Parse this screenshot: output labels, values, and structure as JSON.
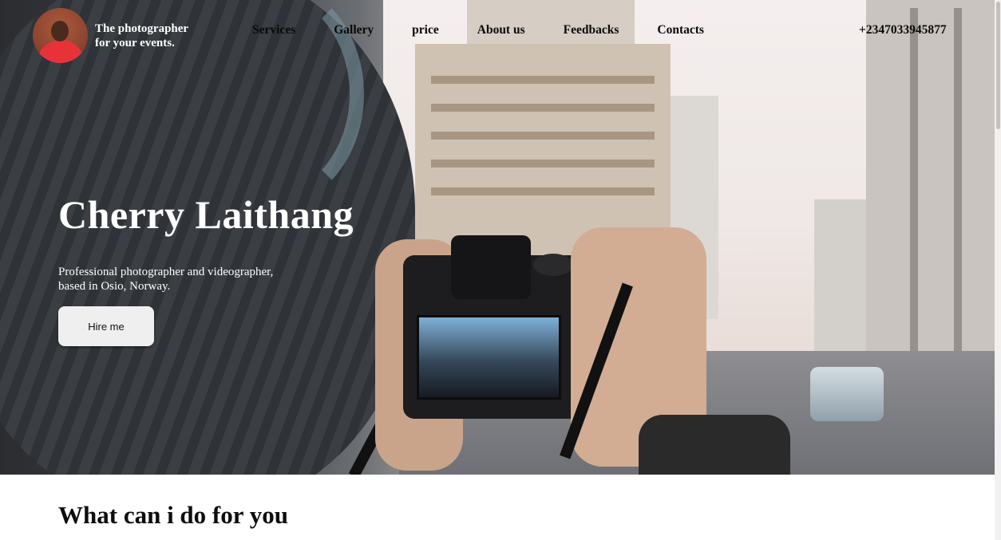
{
  "header": {
    "brand_line1": "The photographer",
    "brand_line2": "for your events.",
    "nav": [
      "Services",
      "Gallery",
      "price",
      "About us",
      "Feedbacks",
      "Contacts"
    ],
    "phone": "+2347033945877"
  },
  "hero": {
    "title": "Cherry Laithang",
    "subtitle_line1": "Professional photographer and videographer,",
    "subtitle_line2": "based in Osio, Norway.",
    "cta_label": "Hire me"
  },
  "section": {
    "title": "What can i do for you"
  },
  "colors": {
    "text_light": "#ffffff",
    "text_dark": "#0a0a0a",
    "button_bg": "#efefef"
  }
}
